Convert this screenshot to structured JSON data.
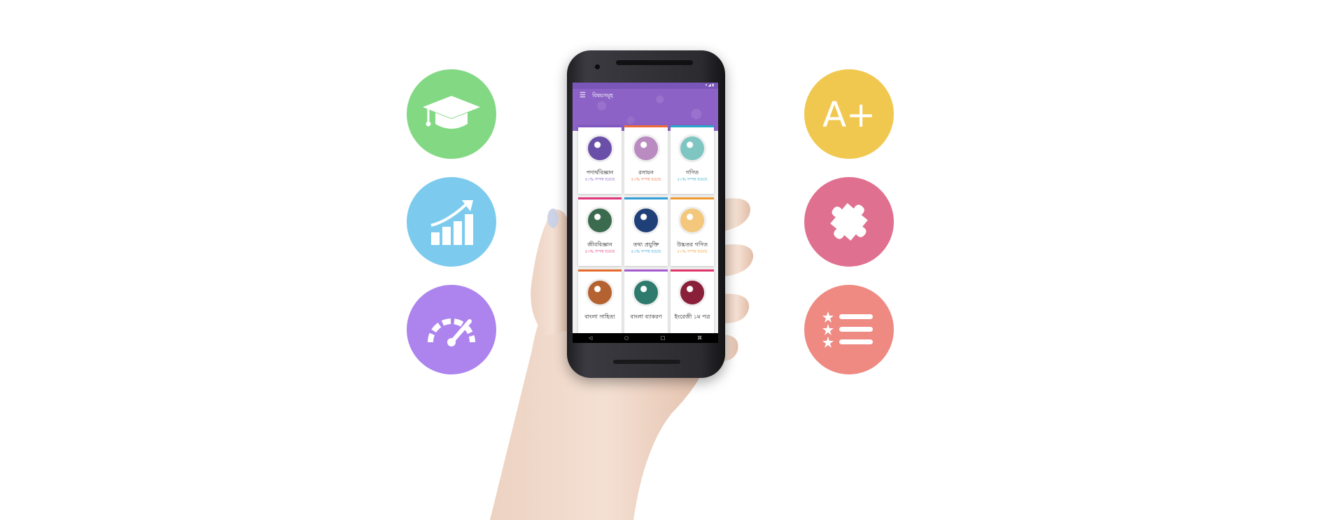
{
  "features_left": [
    {
      "icon": "graduation-cap-icon",
      "color": "#83d884"
    },
    {
      "icon": "growth-chart-icon",
      "color": "#7ccbee"
    },
    {
      "icon": "speedometer-icon",
      "color": "#ad84ee"
    }
  ],
  "features_right": [
    {
      "icon": "a-plus-grade-icon",
      "color": "#f1c84f",
      "label": "A+"
    },
    {
      "icon": "puzzle-piece-icon",
      "color": "#e0708f"
    },
    {
      "icon": "star-list-icon",
      "color": "#ee8a82"
    }
  ],
  "app": {
    "title": "বিষয়সমূহ",
    "status_icons": "▾ ◢ ▮",
    "accent": "#8c62c6",
    "subjects": [
      {
        "name": "পদার্থবিজ্ঞান",
        "status": "৫০% সম্পন্ন হয়েছে",
        "color": "#7e57c2",
        "cover": "#6a4fa8"
      },
      {
        "name": "রসায়ন",
        "status": "৫০% সম্পন্ন হয়েছে",
        "color": "#ef6c3a",
        "cover": "#b98bc0"
      },
      {
        "name": "গণিত",
        "status": "৫০% সম্পন্ন হয়েছে",
        "color": "#26a9c8",
        "cover": "#7fc6c2"
      },
      {
        "name": "জীববিজ্ঞান",
        "status": "৫০% সম্পন্ন হয়েছে",
        "color": "#e0357a",
        "cover": "#3b6b4e"
      },
      {
        "name": "তথ্য প্রযুক্তি",
        "status": "৫০% সম্পন্ন হয়েছে",
        "color": "#2f9fd6",
        "cover": "#1f3f78"
      },
      {
        "name": "উচ্চতর গণিত",
        "status": "৫০% সম্পন্ন হয়েছে",
        "color": "#f09b2f",
        "cover": "#f3c77c"
      },
      {
        "name": "বাংলা সাহিত্য",
        "status": "",
        "color": "#e56a2a",
        "cover": "#b4622f"
      },
      {
        "name": "বাংলা ব্যাকরণ",
        "status": "",
        "color": "#a35ad0",
        "cover": "#2e7a6d"
      },
      {
        "name": "ইংরেজী ১ম পত্র",
        "status": "",
        "color": "#e0356a",
        "cover": "#8a1f3a"
      }
    ],
    "nav": [
      "◁",
      "○",
      "□",
      "⌘"
    ]
  }
}
